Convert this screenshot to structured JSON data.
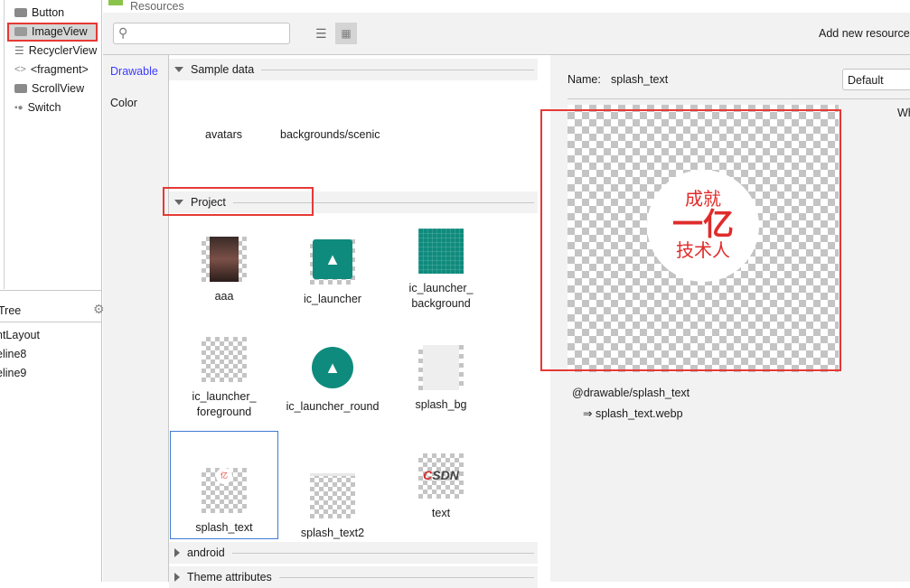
{
  "palette": {
    "items": [
      {
        "label": "Button",
        "icon": "button-icon"
      },
      {
        "label": "ImageView",
        "icon": "image-icon",
        "selected": true
      },
      {
        "label": "RecyclerView",
        "icon": "list-icon"
      },
      {
        "label": "<fragment>",
        "icon": "code-brackets-icon"
      },
      {
        "label": "ScrollView",
        "icon": "scrollview-icon"
      },
      {
        "label": "Switch",
        "icon": "switch-icon"
      }
    ]
  },
  "component_tree": {
    "title": "Tree",
    "rows": [
      "ntLayout",
      "eline8",
      "eline9"
    ]
  },
  "dialog": {
    "title": "Resources",
    "search_placeholder": "",
    "add_new_resource": "Add new resource",
    "categories": [
      "Drawable",
      "Color"
    ],
    "active_category": "Drawable",
    "sections": {
      "sample_data": {
        "title": "Sample data",
        "items": [
          "avatars",
          "backgrounds/scenic"
        ]
      },
      "project": {
        "title": "Project",
        "items": [
          "aaa",
          "ic_launcher",
          "ic_launcher_ background",
          "ic_launcher_ foreground",
          "ic_launcher_round",
          "splash_bg",
          "splash_text",
          "splash_text2",
          "text"
        ],
        "selected": "splash_text"
      },
      "android": {
        "title": "android"
      },
      "theme": {
        "title": "Theme attributes"
      }
    },
    "detail": {
      "name_label": "Name:",
      "name_value": "splash_text",
      "config_select": "Default",
      "side_label": "Wh",
      "preview_text": [
        "成就",
        "一亿",
        "技术人"
      ],
      "reference": "@drawable/splash_text",
      "file": "⇒ splash_text.webp"
    },
    "colors": {
      "accent": "#3b3bff",
      "highlight": "#e53935",
      "launcher": "#0f8b7d",
      "selection": "#3d7bd6"
    }
  }
}
